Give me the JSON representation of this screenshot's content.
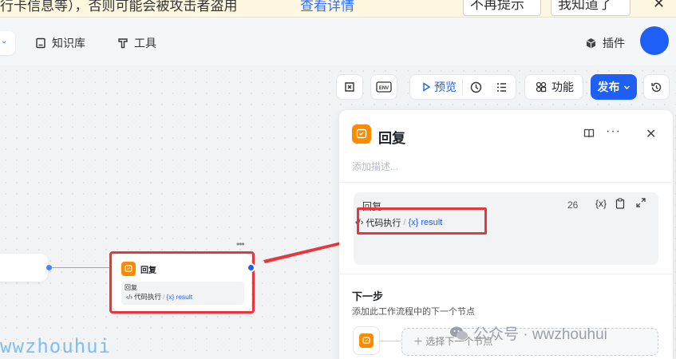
{
  "banner": {
    "text": "行卡信息等），否则可能会被攻击者盗用",
    "link": "查看详情",
    "dismiss_label": "不再提示",
    "ack_label": "我知道了",
    "close_glyph": "✕"
  },
  "nav": {
    "knowledge_label": "知识库",
    "tools_label": "工具",
    "plugins_label": "插件"
  },
  "toolbar": {
    "preview_label": "预览",
    "features_label": "功能",
    "publish_label": "发布",
    "env_label": "ENV"
  },
  "node": {
    "title": "回复",
    "subtitle": "回复",
    "var_source": "代码执行",
    "var_sep": "/",
    "var_name": "result",
    "var_prefix": "{x}",
    "more": "•••"
  },
  "panel": {
    "title": "回复",
    "description_placeholder": "添加描述...",
    "content_label": "回复",
    "char_count": "26",
    "var_source": "代码执行",
    "var_sep": "/",
    "var_prefix": "{x}",
    "var_name": "result",
    "var_icon": "{x}",
    "next_title": "下一步",
    "next_desc": "添加此工作流程中的下一个节点",
    "select_next": "选择下一个节点",
    "more": "···",
    "close": "✕"
  },
  "watermark": {
    "left": "wwzhouhui",
    "right": "公众号 · wwzhouhui"
  },
  "colors": {
    "accent": "#1e5ff5",
    "node_icon": "#ff8a00",
    "highlight": "#e8363c"
  }
}
